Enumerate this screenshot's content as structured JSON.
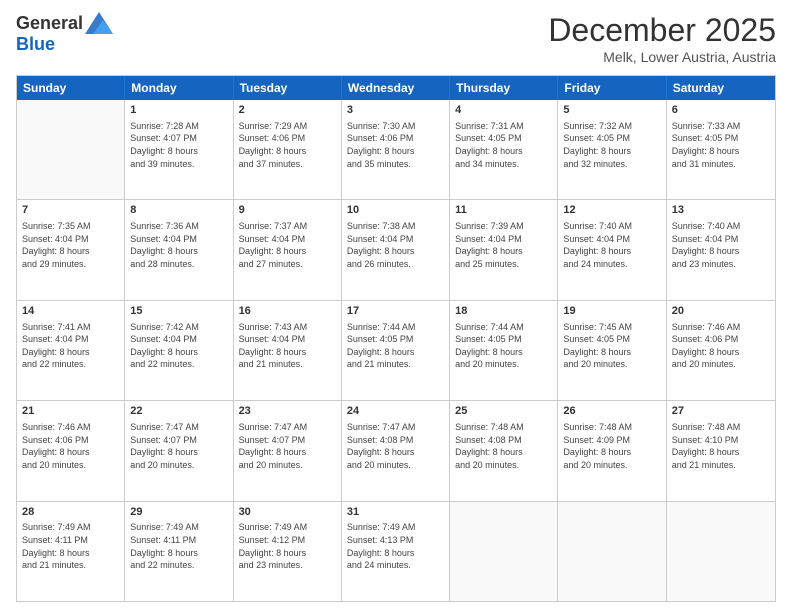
{
  "header": {
    "logo": {
      "general": "General",
      "blue": "Blue"
    },
    "title": "December 2025",
    "location": "Melk, Lower Austria, Austria"
  },
  "days_of_week": [
    "Sunday",
    "Monday",
    "Tuesday",
    "Wednesday",
    "Thursday",
    "Friday",
    "Saturday"
  ],
  "weeks": [
    [
      {
        "day": "",
        "empty": true
      },
      {
        "day": "1",
        "sunrise": "7:28 AM",
        "sunset": "4:07 PM",
        "daylight": "8 hours and 39 minutes."
      },
      {
        "day": "2",
        "sunrise": "7:29 AM",
        "sunset": "4:06 PM",
        "daylight": "8 hours and 37 minutes."
      },
      {
        "day": "3",
        "sunrise": "7:30 AM",
        "sunset": "4:06 PM",
        "daylight": "8 hours and 35 minutes."
      },
      {
        "day": "4",
        "sunrise": "7:31 AM",
        "sunset": "4:05 PM",
        "daylight": "8 hours and 34 minutes."
      },
      {
        "day": "5",
        "sunrise": "7:32 AM",
        "sunset": "4:05 PM",
        "daylight": "8 hours and 32 minutes."
      },
      {
        "day": "6",
        "sunrise": "7:33 AM",
        "sunset": "4:05 PM",
        "daylight": "8 hours and 31 minutes."
      }
    ],
    [
      {
        "day": "7",
        "sunrise": "7:35 AM",
        "sunset": "4:04 PM",
        "daylight": "8 hours and 29 minutes."
      },
      {
        "day": "8",
        "sunrise": "7:36 AM",
        "sunset": "4:04 PM",
        "daylight": "8 hours and 28 minutes."
      },
      {
        "day": "9",
        "sunrise": "7:37 AM",
        "sunset": "4:04 PM",
        "daylight": "8 hours and 27 minutes."
      },
      {
        "day": "10",
        "sunrise": "7:38 AM",
        "sunset": "4:04 PM",
        "daylight": "8 hours and 26 minutes."
      },
      {
        "day": "11",
        "sunrise": "7:39 AM",
        "sunset": "4:04 PM",
        "daylight": "8 hours and 25 minutes."
      },
      {
        "day": "12",
        "sunrise": "7:40 AM",
        "sunset": "4:04 PM",
        "daylight": "8 hours and 24 minutes."
      },
      {
        "day": "13",
        "sunrise": "7:40 AM",
        "sunset": "4:04 PM",
        "daylight": "8 hours and 23 minutes."
      }
    ],
    [
      {
        "day": "14",
        "sunrise": "7:41 AM",
        "sunset": "4:04 PM",
        "daylight": "8 hours and 22 minutes."
      },
      {
        "day": "15",
        "sunrise": "7:42 AM",
        "sunset": "4:04 PM",
        "daylight": "8 hours and 22 minutes."
      },
      {
        "day": "16",
        "sunrise": "7:43 AM",
        "sunset": "4:04 PM",
        "daylight": "8 hours and 21 minutes."
      },
      {
        "day": "17",
        "sunrise": "7:44 AM",
        "sunset": "4:05 PM",
        "daylight": "8 hours and 21 minutes."
      },
      {
        "day": "18",
        "sunrise": "7:44 AM",
        "sunset": "4:05 PM",
        "daylight": "8 hours and 20 minutes."
      },
      {
        "day": "19",
        "sunrise": "7:45 AM",
        "sunset": "4:05 PM",
        "daylight": "8 hours and 20 minutes."
      },
      {
        "day": "20",
        "sunrise": "7:46 AM",
        "sunset": "4:06 PM",
        "daylight": "8 hours and 20 minutes."
      }
    ],
    [
      {
        "day": "21",
        "sunrise": "7:46 AM",
        "sunset": "4:06 PM",
        "daylight": "8 hours and 20 minutes."
      },
      {
        "day": "22",
        "sunrise": "7:47 AM",
        "sunset": "4:07 PM",
        "daylight": "8 hours and 20 minutes."
      },
      {
        "day": "23",
        "sunrise": "7:47 AM",
        "sunset": "4:07 PM",
        "daylight": "8 hours and 20 minutes."
      },
      {
        "day": "24",
        "sunrise": "7:47 AM",
        "sunset": "4:08 PM",
        "daylight": "8 hours and 20 minutes."
      },
      {
        "day": "25",
        "sunrise": "7:48 AM",
        "sunset": "4:08 PM",
        "daylight": "8 hours and 20 minutes."
      },
      {
        "day": "26",
        "sunrise": "7:48 AM",
        "sunset": "4:09 PM",
        "daylight": "8 hours and 20 minutes."
      },
      {
        "day": "27",
        "sunrise": "7:48 AM",
        "sunset": "4:10 PM",
        "daylight": "8 hours and 21 minutes."
      }
    ],
    [
      {
        "day": "28",
        "sunrise": "7:49 AM",
        "sunset": "4:11 PM",
        "daylight": "8 hours and 21 minutes."
      },
      {
        "day": "29",
        "sunrise": "7:49 AM",
        "sunset": "4:11 PM",
        "daylight": "8 hours and 22 minutes."
      },
      {
        "day": "30",
        "sunrise": "7:49 AM",
        "sunset": "4:12 PM",
        "daylight": "8 hours and 23 minutes."
      },
      {
        "day": "31",
        "sunrise": "7:49 AM",
        "sunset": "4:13 PM",
        "daylight": "8 hours and 24 minutes."
      },
      {
        "day": "",
        "empty": true
      },
      {
        "day": "",
        "empty": true
      },
      {
        "day": "",
        "empty": true
      }
    ]
  ]
}
